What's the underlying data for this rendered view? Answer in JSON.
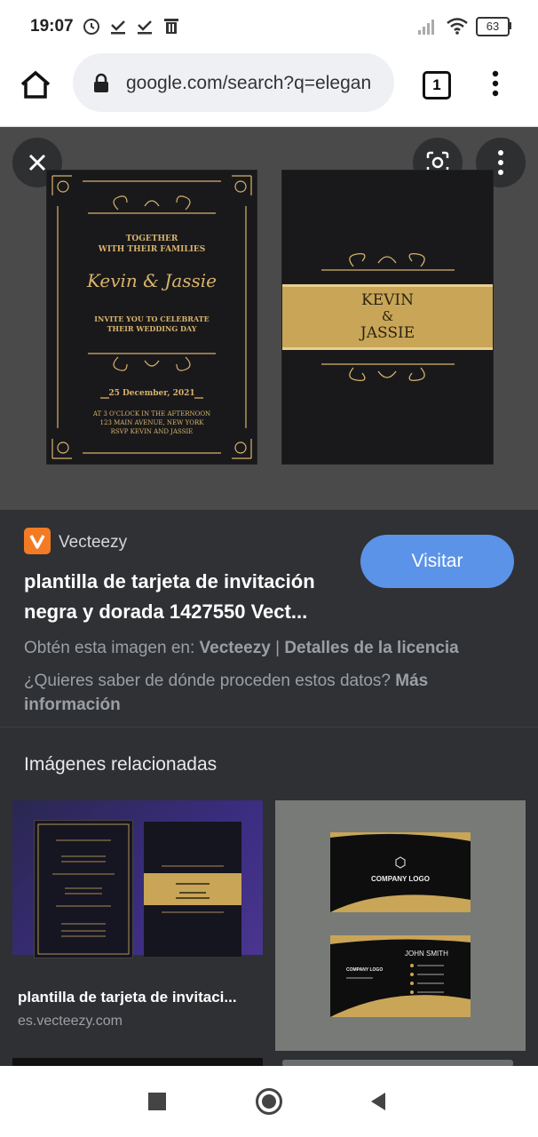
{
  "status_bar": {
    "time": "19:07",
    "battery": "63",
    "icons": [
      "alarm-icon",
      "download-done-icon",
      "download-done-icon",
      "trash-icon",
      "signal-icon",
      "wifi-icon",
      "battery-icon"
    ]
  },
  "browser": {
    "url": "google.com/search?q=elegan",
    "tab_count": "1"
  },
  "invitation": {
    "line1": "TOGETHER",
    "line2": "WITH THEIR FAMILIES",
    "names": "Kevin & Jassie",
    "invite1": "INVITE YOU TO CELEBRATE",
    "invite2": "THEIR WEDDING DAY",
    "date": "25 December, 2021",
    "time": "AT 3 O'CLOCK IN THE AFTERNOON",
    "address": "123 MAIN AVENUE, NEW YORK",
    "rsvp": "RSVP KEVIN AND JASSIE",
    "back_name1": "KEVIN",
    "back_amp": "&",
    "back_name2": "JASSIE"
  },
  "result": {
    "source": "Vecteezy",
    "title": "plantilla de tarjeta de invitación negra y dorada 1427550 Vect...",
    "visit_label": "Visitar",
    "obtain_prefix": "Obtén esta imagen en: ",
    "obtain_source": "Vecteezy",
    "separator": " | ",
    "license": "Detalles de la licencia",
    "question": "¿Quieres saber de dónde proceden estos datos? ",
    "more_info": "Más información"
  },
  "related": {
    "heading": "Imágenes relacionadas",
    "items": [
      {
        "title": "plantilla de tarjeta de invitaci...",
        "source": "es.vecteezy.com"
      },
      {
        "title": "",
        "source": "",
        "logo_text": "COMPANY LOGO",
        "name_text": "JOHN SMITH"
      }
    ]
  },
  "colors": {
    "accent": "#5b93e8",
    "gold": "#d8b36a",
    "panel": "#303134"
  }
}
